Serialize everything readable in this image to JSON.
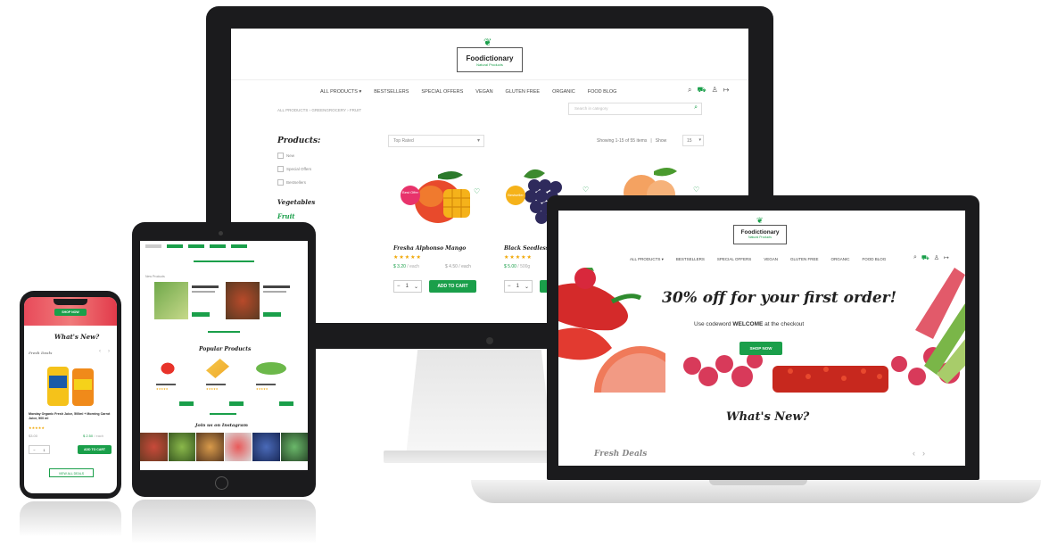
{
  "brand": {
    "name": "Foodictionary",
    "tagline": "Natural Products"
  },
  "colors": {
    "accent": "#1a9f4a",
    "bezel": "#1b1b1d",
    "star": "#f0a500"
  },
  "desktop": {
    "nav": [
      "ALL PRODUCTS ▾",
      "BESTSELLERS",
      "SPECIAL OFFERS",
      "VEGAN",
      "GLUTEN FREE",
      "ORGANIC",
      "FOOD BLOG"
    ],
    "breadcrumb": "ALL PRODUCTS › GREENGROCERY › FRUIT",
    "search_placeholder": "Search in category",
    "sort_value": "Top Rated",
    "showing_text": "Showing 1-15 of 55 items",
    "show_label": "Show",
    "show_value": "15",
    "filters_title": "Products:",
    "filters": [
      "New",
      "Special Offers",
      "Bestsellers"
    ],
    "category_title": "Vegetables",
    "category_active": "Fruit",
    "products": [
      {
        "name": "Fresha Alphonso Mango",
        "price": "$ 3.20",
        "unit": "/ each",
        "old_price": "$ 4.50",
        "old_unit": "/ each",
        "badge": "Best Offer",
        "qty": "1",
        "button": "ADD TO CART"
      },
      {
        "name": "Black Seedless G",
        "price": "$ 5.00",
        "unit": "/ 500g",
        "badge": "Bestseller",
        "qty": "1",
        "button": ""
      },
      {
        "name": "",
        "price": "",
        "unit": ""
      }
    ]
  },
  "laptop": {
    "nav": [
      "ALL PRODUCTS ▾",
      "BESTSELLERS",
      "SPECIAL OFFERS",
      "VEGAN",
      "GLUTEN FREE",
      "ORGANIC",
      "FOOD BLOG"
    ],
    "hero_title": "30% off for your first order!",
    "hero_sub_before": "Use codeword",
    "hero_code": "WELCOME",
    "hero_sub_after": "at the checkout",
    "hero_button": "SHOP NOW",
    "section_title": "What's New?",
    "deals_label": "Fresh Deals"
  },
  "tablet": {
    "section_label": "New Products",
    "popular_title": "Popular Products",
    "instagram_title": "Join us on Instagram"
  },
  "phone": {
    "top_button": "SHOP NOW",
    "section_title": "What's New?",
    "deals_label": "Fresh Deals",
    "product_name": "Monday Organic Fresh Juice, 500ml + Morning Carrot Juice, 500 ml",
    "price_old": "$3.00",
    "price": "$ 2.50",
    "price_unit": "/ each",
    "qty": "1",
    "button": "ADD TO CART",
    "view_all": "VIEW ALL DEALS"
  }
}
